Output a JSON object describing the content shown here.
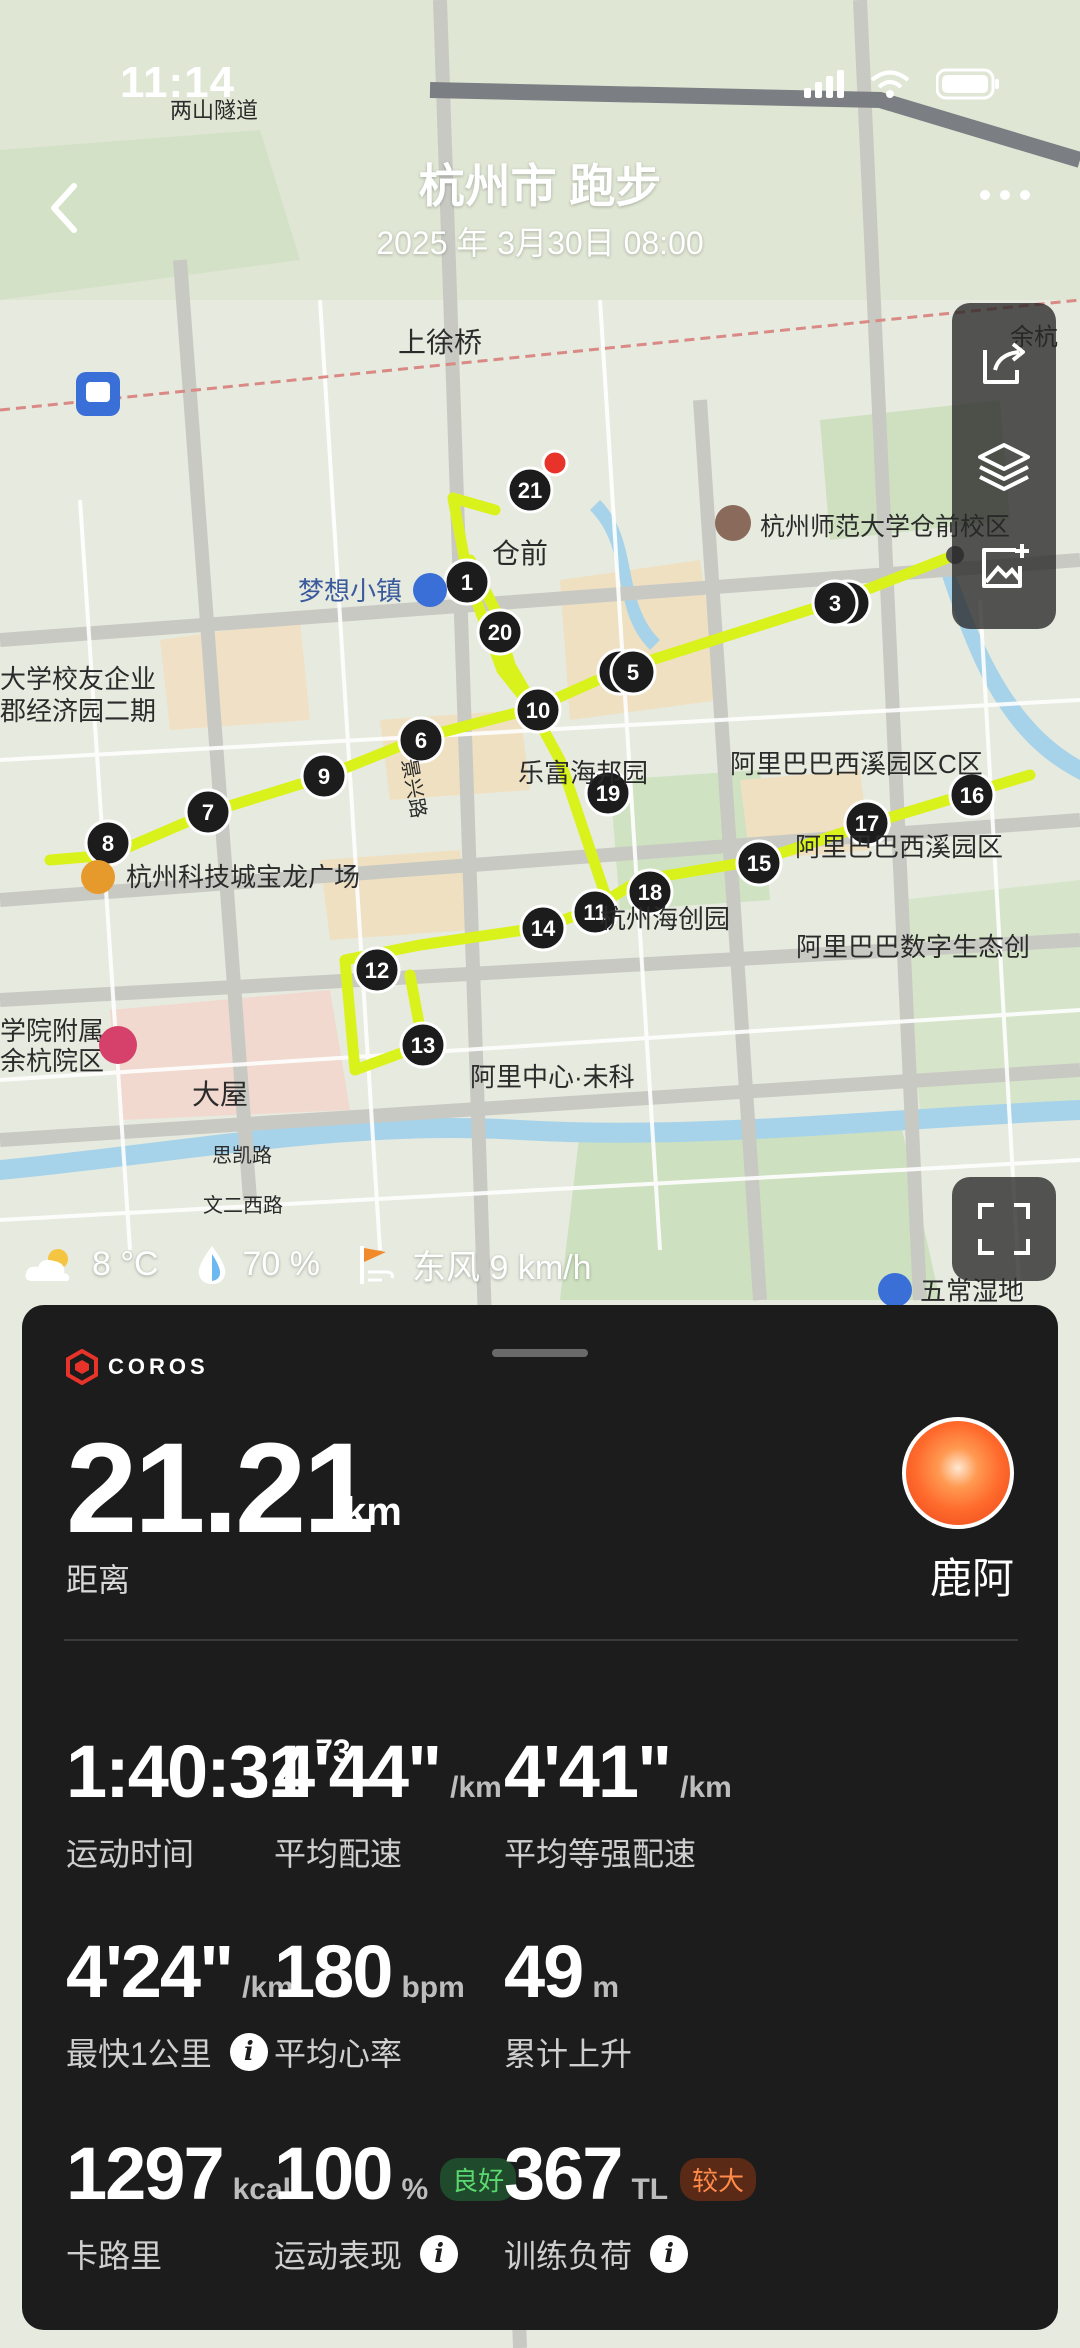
{
  "status_bar": {
    "time": "11:14"
  },
  "header": {
    "title": "杭州市 跑步",
    "subtitle": "2025 年 3月30日 08:00"
  },
  "map": {
    "labels": [
      {
        "id": "lianshan",
        "text": "两山隧道"
      },
      {
        "id": "shangxuqiao",
        "text": "上徐桥"
      },
      {
        "id": "yuhang",
        "text": "余杭"
      },
      {
        "id": "mengxiang",
        "text": "梦想小镇"
      },
      {
        "id": "cangqian",
        "text": "仓前"
      },
      {
        "id": "shifan",
        "text": "杭州师范大学仓前校区"
      },
      {
        "id": "daxue1",
        "text": "大学校友企业"
      },
      {
        "id": "daxue2",
        "text": "郡经济园二期"
      },
      {
        "id": "leguan",
        "text": "乐富海邦园"
      },
      {
        "id": "alibaba_c",
        "text": "阿里巴巴西溪园区C区"
      },
      {
        "id": "alibaba_b",
        "text": "阿里巴巴西溪园区"
      },
      {
        "id": "baolong",
        "text": "杭州科技城宝龙广场"
      },
      {
        "id": "haichuang",
        "text": "杭州海创园"
      },
      {
        "id": "shuzi",
        "text": "阿里巴巴数字生态创"
      },
      {
        "id": "jingxing",
        "text": "景兴路"
      },
      {
        "id": "hospital1",
        "text": "学院附属"
      },
      {
        "id": "hospital2",
        "text": "余杭院区"
      },
      {
        "id": "dawu",
        "text": "大屋"
      },
      {
        "id": "alicenter",
        "text": "阿里中心·未科"
      },
      {
        "id": "sikai",
        "text": "思凯路"
      },
      {
        "id": "wenersi",
        "text": "文二西路"
      },
      {
        "id": "wuchang",
        "text": "五常湿地"
      }
    ],
    "km_markers": [
      "1",
      "2",
      "3",
      "4",
      "5",
      "6",
      "7",
      "8",
      "9",
      "10",
      "11",
      "12",
      "13",
      "14",
      "15",
      "16",
      "17",
      "18",
      "19",
      "20",
      "21"
    ]
  },
  "weather": {
    "temp": "8 °C",
    "humidity": "70 %",
    "wind": "东风 9 km/h"
  },
  "panel": {
    "brand": "COROS",
    "distance": {
      "value": "21.21",
      "unit": "km",
      "label": "距离"
    },
    "user": {
      "name": "鹿阿"
    },
    "stats": [
      {
        "value": "1:40:31",
        "sup": "73",
        "unit": "",
        "label": "运动时间"
      },
      {
        "value": "4'44\"",
        "unit": "/km",
        "label": "平均配速"
      },
      {
        "value": "4'41\"",
        "unit": "/km",
        "label": "平均等强配速"
      },
      {
        "value": "4'24\"",
        "unit": "/km",
        "label": "最快1公里"
      },
      {
        "value": "180",
        "unit": "bpm",
        "label": "平均心率"
      },
      {
        "value": "49",
        "unit": "m",
        "label": "累计上升"
      },
      {
        "value": "1297",
        "unit": "kcal",
        "label": "卡路里"
      },
      {
        "value": "100",
        "unit": "%",
        "badge": "良好",
        "label": "运动表现"
      },
      {
        "value": "367",
        "unit": "TL",
        "badge": "较大",
        "label": "训练负荷"
      }
    ]
  },
  "colors": {
    "route": "#d9f21b",
    "panel_bg": "#1c1c1c",
    "badge_good": "#59d96f",
    "badge_big": "#ff8a4a",
    "coros_red": "#e8332a"
  }
}
